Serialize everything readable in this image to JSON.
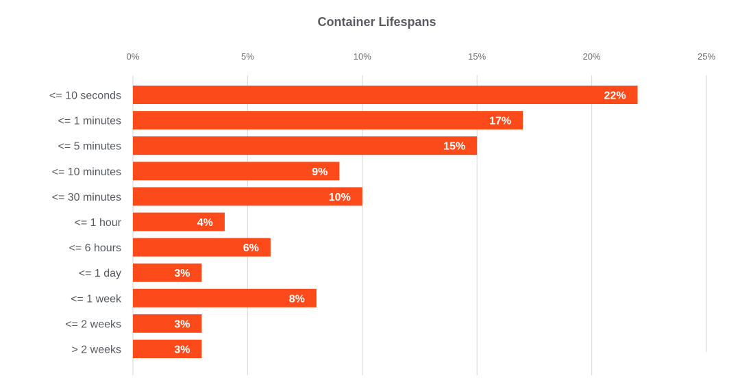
{
  "chart_data": {
    "type": "bar",
    "orientation": "horizontal",
    "title": "Container Lifespans",
    "xlabel": "",
    "ylabel": "",
    "xlim": [
      0,
      25
    ],
    "x_ticks": [
      0,
      5,
      10,
      15,
      20,
      25
    ],
    "x_tick_labels": [
      "0%",
      "5%",
      "10%",
      "15%",
      "20%",
      "25%"
    ],
    "x_axis_position": "top",
    "grid": true,
    "legend": "none",
    "bar_color": "#fc4a1a",
    "categories": [
      "<= 10 seconds",
      "<= 1 minutes",
      "<= 5 minutes",
      "<= 10 minutes",
      "<= 30 minutes",
      "<= 1 hour",
      "<= 6 hours",
      "<= 1 day",
      "<= 1 week",
      "<= 2 weeks",
      "> 2 weeks"
    ],
    "values": [
      22,
      17,
      15,
      9,
      10,
      4,
      6,
      3,
      8,
      3,
      3
    ],
    "data_labels": [
      "22%",
      "17%",
      "15%",
      "9%",
      "10%",
      "4%",
      "6%",
      "3%",
      "8%",
      "3%",
      "3%"
    ]
  }
}
